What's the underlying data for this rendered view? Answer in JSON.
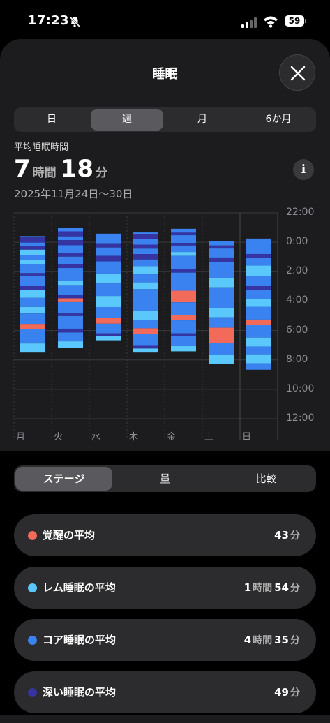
{
  "status_bar": {
    "time": "17:23",
    "battery": "59"
  },
  "header": {
    "title": "睡眠"
  },
  "period_tabs": [
    {
      "label": "日",
      "active": false
    },
    {
      "label": "週",
      "active": true
    },
    {
      "label": "月",
      "active": false
    },
    {
      "label": "6か月",
      "active": false
    }
  ],
  "summary": {
    "label": "平均睡眠時間",
    "hours": "7",
    "hours_unit": "時間",
    "minutes": "18",
    "minutes_unit": "分",
    "date_range": "2025年11月24日〜30日",
    "info_icon": "i"
  },
  "colors": {
    "awake": "#f26a5a",
    "rem": "#5ac8fa",
    "core": "#3a82f0",
    "deep": "#3634a3"
  },
  "chart_data": {
    "type": "bar",
    "orientation": "vertical-timeline",
    "y_axis_labels": [
      "22:00",
      "0:00",
      "2:00",
      "4:00",
      "6:00",
      "8:00",
      "10:00",
      "12:00"
    ],
    "ylim_hours_from_2200": [
      0,
      14
    ],
    "categories": [
      "月",
      "火",
      "水",
      "木",
      "金",
      "土",
      "日"
    ],
    "series": [
      {
        "day": "月",
        "start": "23:35",
        "end": "07:30",
        "segments": [
          [
            "core",
            0.05
          ],
          [
            "deep",
            0.2
          ],
          [
            "core",
            0.12
          ],
          [
            "deep",
            0.15
          ],
          [
            "rem",
            0.2
          ],
          [
            "core",
            0.2
          ],
          [
            "rem",
            0.15
          ],
          [
            "core",
            0.35
          ],
          [
            "deep",
            0.1
          ],
          [
            "core",
            0.4
          ],
          [
            "deep",
            0.15
          ],
          [
            "rem",
            0.3
          ],
          [
            "core",
            0.35
          ],
          [
            "rem",
            0.25
          ],
          [
            "core",
            0.4
          ],
          [
            "awake",
            0.2
          ],
          [
            "core",
            0.55
          ],
          [
            "rem",
            0.35
          ]
        ]
      },
      {
        "day": "火",
        "start": "23:00",
        "end": "07:10",
        "segments": [
          [
            "core",
            0.15
          ],
          [
            "deep",
            0.2
          ],
          [
            "core",
            0.15
          ],
          [
            "deep",
            0.2
          ],
          [
            "core",
            0.3
          ],
          [
            "deep",
            0.15
          ],
          [
            "core",
            0.3
          ],
          [
            "deep",
            0.15
          ],
          [
            "core",
            0.5
          ],
          [
            "rem",
            0.2
          ],
          [
            "core",
            0.35
          ],
          [
            "deep",
            0.15
          ],
          [
            "awake",
            0.15
          ],
          [
            "core",
            0.45
          ],
          [
            "deep",
            0.1
          ],
          [
            "core",
            0.5
          ],
          [
            "deep",
            0.15
          ],
          [
            "core",
            0.35
          ],
          [
            "rem",
            0.25
          ]
        ]
      },
      {
        "day": "水",
        "start": "23:25",
        "end": "06:40",
        "segments": [
          [
            "core",
            0.35
          ],
          [
            "deep",
            0.15
          ],
          [
            "core",
            0.3
          ],
          [
            "deep",
            0.2
          ],
          [
            "core",
            0.45
          ],
          [
            "rem",
            0.35
          ],
          [
            "core",
            0.45
          ],
          [
            "rem",
            0.4
          ],
          [
            "core",
            0.4
          ],
          [
            "awake",
            0.2
          ],
          [
            "core",
            0.35
          ],
          [
            "deep",
            0.1
          ],
          [
            "rem",
            0.15
          ]
        ]
      },
      {
        "day": "木",
        "start": "23:20",
        "end": "07:30",
        "segments": [
          [
            "core",
            0.05
          ],
          [
            "deep",
            0.2
          ],
          [
            "core",
            0.2
          ],
          [
            "deep",
            0.15
          ],
          [
            "core",
            0.2
          ],
          [
            "deep",
            0.2
          ],
          [
            "core",
            0.25
          ],
          [
            "rem",
            0.3
          ],
          [
            "core",
            0.3
          ],
          [
            "rem",
            0.25
          ],
          [
            "core",
            0.8
          ],
          [
            "rem",
            0.35
          ],
          [
            "core",
            0.3
          ],
          [
            "awake",
            0.2
          ],
          [
            "core",
            0.45
          ],
          [
            "deep",
            0.1
          ],
          [
            "rem",
            0.15
          ]
        ]
      },
      {
        "day": "金",
        "start": "23:05",
        "end": "07:25",
        "segments": [
          [
            "core",
            0.15
          ],
          [
            "deep",
            0.1
          ],
          [
            "core",
            0.3
          ],
          [
            "deep",
            0.1
          ],
          [
            "core",
            0.25
          ],
          [
            "rem",
            0.15
          ],
          [
            "core",
            0.5
          ],
          [
            "deep",
            0.15
          ],
          [
            "core",
            0.7
          ],
          [
            "awake",
            0.45
          ],
          [
            "core",
            0.5
          ],
          [
            "awake",
            0.2
          ],
          [
            "core",
            0.5
          ],
          [
            "deep",
            0.1
          ],
          [
            "core",
            0.4
          ],
          [
            "rem",
            0.2
          ]
        ]
      },
      {
        "day": "土",
        "start": "23:55",
        "end": "08:15",
        "segments": [
          [
            "core",
            0.15
          ],
          [
            "deep",
            0.1
          ],
          [
            "core",
            0.3
          ],
          [
            "deep",
            0.15
          ],
          [
            "core",
            0.55
          ],
          [
            "rem",
            0.3
          ],
          [
            "core",
            0.7
          ],
          [
            "rem",
            0.3
          ],
          [
            "core",
            0.35
          ],
          [
            "awake",
            0.5
          ],
          [
            "core",
            0.4
          ],
          [
            "rem",
            0.3
          ]
        ]
      },
      {
        "day": "日",
        "start": "23:45",
        "end": "08:40",
        "segments": [
          [
            "core",
            0.6
          ],
          [
            "deep",
            0.15
          ],
          [
            "core",
            0.3
          ],
          [
            "rem",
            0.4
          ],
          [
            "core",
            0.4
          ],
          [
            "deep",
            0.15
          ],
          [
            "core",
            0.35
          ],
          [
            "rem",
            0.3
          ],
          [
            "core",
            0.5
          ],
          [
            "awake",
            0.2
          ],
          [
            "core",
            0.5
          ],
          [
            "rem",
            0.35
          ],
          [
            "core",
            0.3
          ],
          [
            "rem",
            0.35
          ],
          [
            "core",
            0.25
          ]
        ]
      }
    ]
  },
  "detail_tabs": [
    {
      "label": "ステージ",
      "active": true
    },
    {
      "label": "量",
      "active": false
    },
    {
      "label": "比較",
      "active": false
    }
  ],
  "stats": [
    {
      "key": "awake",
      "label": "覚醒の平均",
      "parts": [
        [
          "43",
          "分"
        ]
      ]
    },
    {
      "key": "rem",
      "label": "レム睡眠の平均",
      "parts": [
        [
          "1",
          "時間"
        ],
        [
          "54",
          "分"
        ]
      ]
    },
    {
      "key": "core",
      "label": "コア睡眠の平均",
      "parts": [
        [
          "4",
          "時間"
        ],
        [
          "35",
          "分"
        ]
      ]
    },
    {
      "key": "deep",
      "label": "深い睡眠の平均",
      "parts": [
        [
          "49",
          "分"
        ]
      ]
    }
  ]
}
